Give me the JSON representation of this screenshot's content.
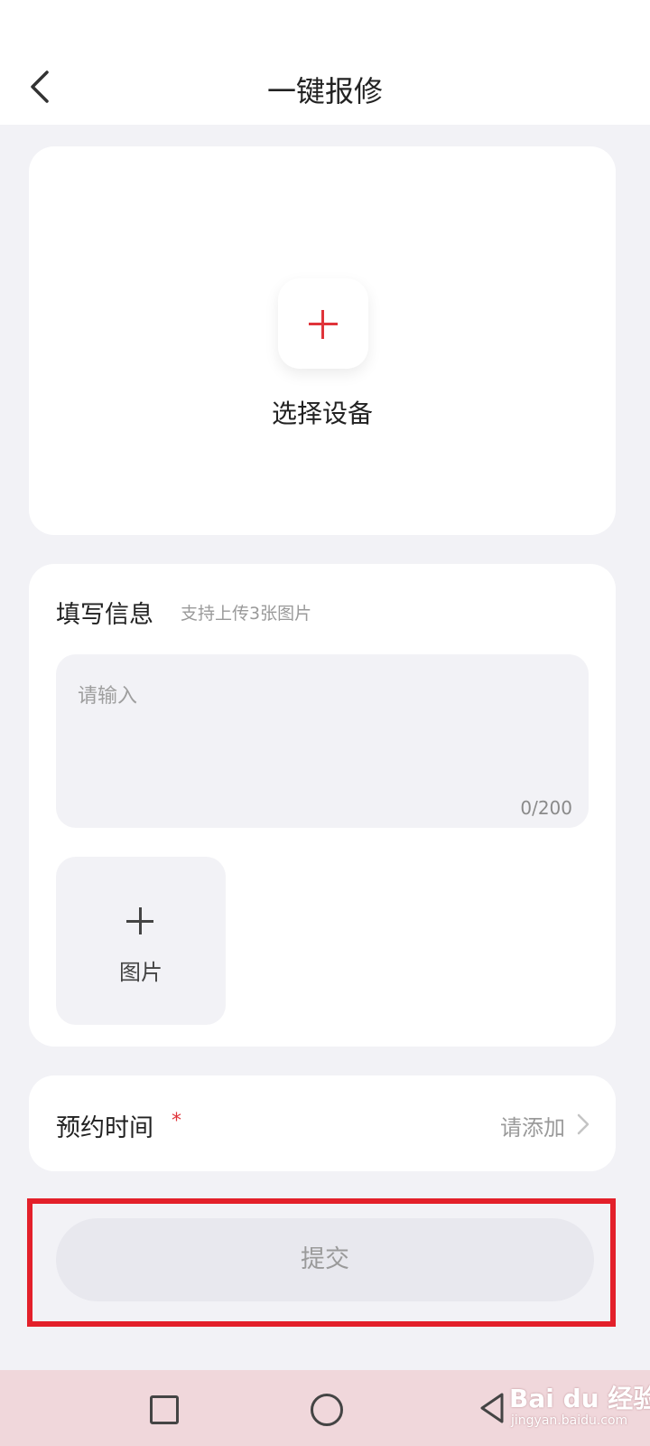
{
  "header": {
    "title": "一键报修"
  },
  "device_card": {
    "label": "选择设备"
  },
  "info_card": {
    "title": "填写信息",
    "hint": "支持上传3张图片",
    "textarea_placeholder": "请输入",
    "char_count": "0/200",
    "image_label": "图片"
  },
  "time_card": {
    "label": "预约时间",
    "required_mark": "*",
    "value_placeholder": "请添加"
  },
  "submit": {
    "label": "提交"
  },
  "watermark": {
    "text": "Bai du 经验",
    "sub": "jingyan.baidu.com"
  },
  "colors": {
    "accent": "#e0343a",
    "highlight_frame": "#e3202a",
    "page_bg": "#f2f2f6"
  }
}
